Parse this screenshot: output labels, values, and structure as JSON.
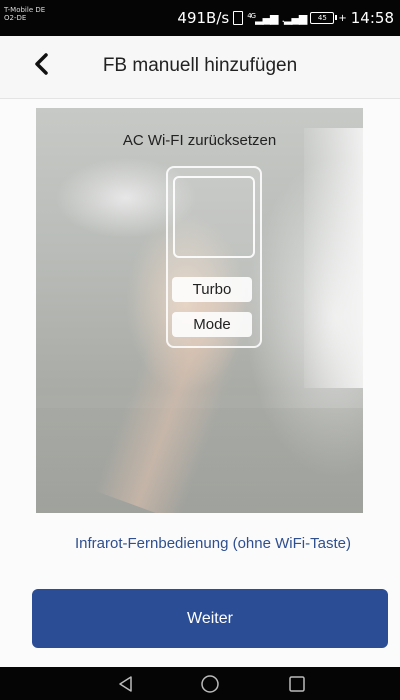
{
  "status_bar": {
    "carrier_line1": "T-Mobile DE",
    "carrier_line2": "O2-DE",
    "network_speed": "491B/s",
    "network_type": "4G",
    "battery_level": "45",
    "time": "14:58",
    "icons": [
      "vibrate-icon",
      "signal-icon",
      "signal-icon",
      "battery-icon"
    ]
  },
  "header": {
    "title": "FB manuell hinzufügen",
    "back_icon": "chevron-left-icon"
  },
  "illustration": {
    "heading": "AC Wi-FI zurücksetzen",
    "remote_buttons": [
      "Turbo",
      "Mode"
    ]
  },
  "link_text": "Infrarot-Fernbedienung (ohne WiFi-Taste)",
  "primary_button": {
    "label": "Weiter",
    "color": "#2a4d96"
  },
  "nav_bar": {
    "icons": [
      "back-triangle-icon",
      "home-circle-icon",
      "recents-square-icon"
    ]
  }
}
